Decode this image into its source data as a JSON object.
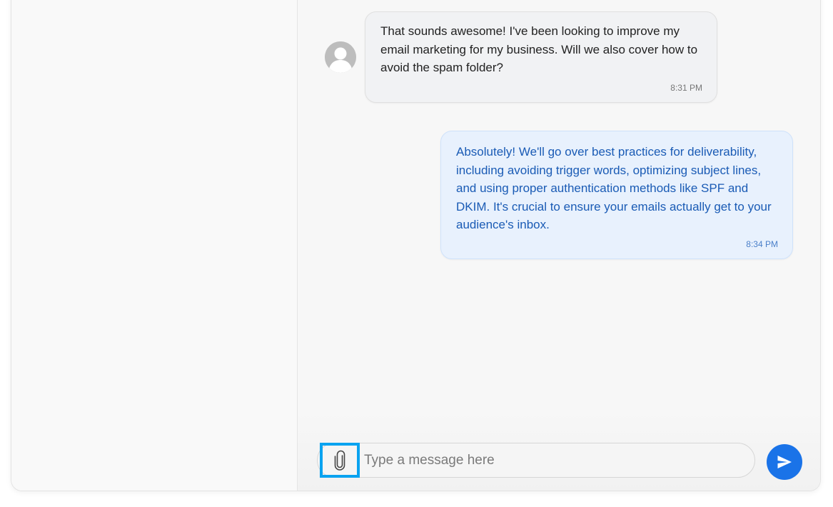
{
  "messages": [
    {
      "direction": "received",
      "text": "That sounds awesome! I've been looking to improve my email marketing for my business. Will we also cover how to avoid the spam folder?",
      "time": "8:31 PM",
      "avatar_icon": "user-avatar-icon"
    },
    {
      "direction": "sent",
      "text": "Absolutely! We'll go over best practices for deliverability, including avoiding trigger words, optimizing subject lines, and using proper authentication methods like SPF and DKIM. It's crucial to ensure your emails actually get to your audience's inbox.",
      "time": "8:34 PM"
    }
  ],
  "composer": {
    "placeholder": "Type a message here",
    "value": "",
    "attach_icon": "paperclip-icon",
    "send_icon": "send-icon"
  },
  "colors": {
    "accent": "#1a73e8",
    "highlight": "#0aa3f0",
    "sent_bubble": "#e8f1fd",
    "sent_text": "#1a5bb5",
    "received_bubble": "#f1f2f4"
  }
}
